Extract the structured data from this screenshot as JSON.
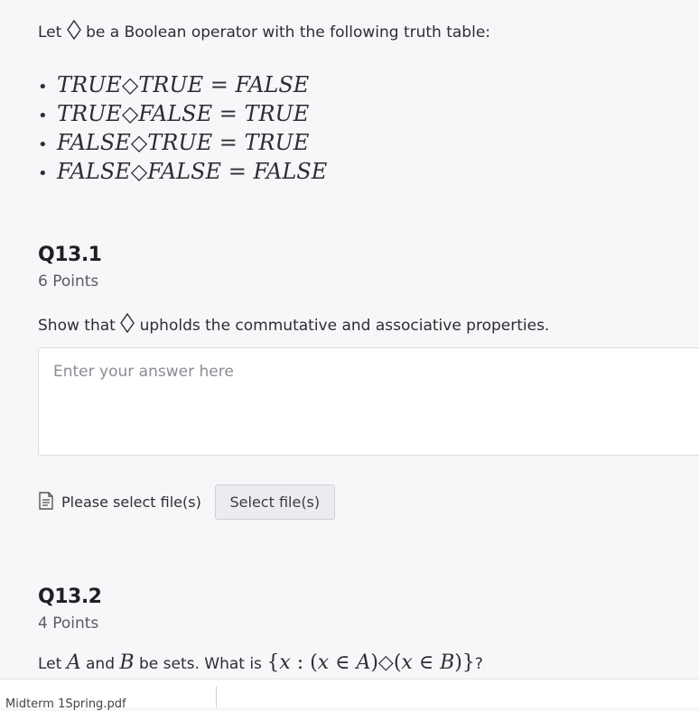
{
  "intro": {
    "prefix": "Let",
    "suffix": "be a Boolean operator with the following truth table:"
  },
  "truth_table": [
    {
      "left": "TRUE",
      "right": "TRUE",
      "result": "FALSE"
    },
    {
      "left": "TRUE",
      "right": "FALSE",
      "result": "TRUE"
    },
    {
      "left": "FALSE",
      "right": "TRUE",
      "result": "TRUE"
    },
    {
      "left": "FALSE",
      "right": "FALSE",
      "result": "FALSE"
    }
  ],
  "q1": {
    "title": "Q13.1",
    "points": "6 Points",
    "text_prefix": "Show that",
    "text_suffix": "upholds the commutative and associative properties.",
    "answer_placeholder": "Enter your answer here",
    "file_label": "Please select file(s)",
    "file_button": "Select file(s)"
  },
  "q2": {
    "title": "Q13.2",
    "points": "4 Points",
    "t1": "Let",
    "a": "A",
    "t2": "and",
    "b": "B",
    "t3": "be sets.  What is",
    "t4": "?"
  },
  "bottom": {
    "text": "Midterm 1Spring.pdf"
  }
}
